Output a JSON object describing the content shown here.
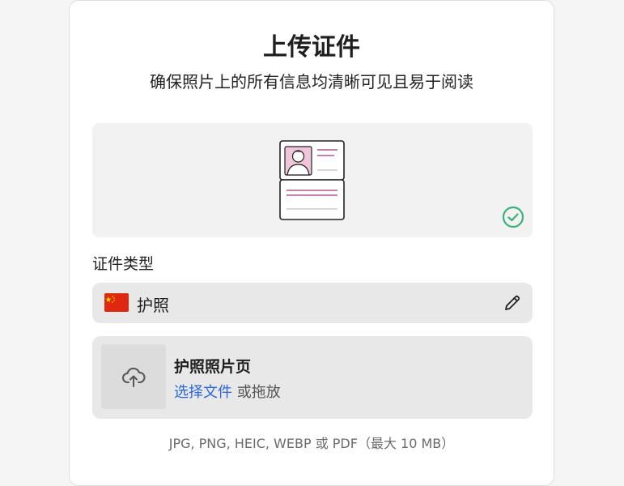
{
  "header": {
    "title": "上传证件",
    "subtitle": "确保照片上的所有信息均清晰可见且易于阅读"
  },
  "illustration": {
    "icon": "id-document-icon",
    "status_icon": "check-circle-icon",
    "status_color": "#3bb07a"
  },
  "document_type": {
    "label": "证件类型",
    "value": "护照",
    "flag": "china-flag-icon",
    "edit_icon": "pencil-icon"
  },
  "upload": {
    "title": "护照照片页",
    "choose_label": "选择文件",
    "drag_label": "或拖放",
    "icon": "cloud-upload-icon",
    "formats": "JPG, PNG, HEIC, WEBP 或 PDF（最大 10 MB）"
  },
  "colors": {
    "link": "#2b67d6",
    "accent_pink": "#b0588f",
    "flag_red": "#de2910",
    "flag_star": "#ffde00"
  }
}
